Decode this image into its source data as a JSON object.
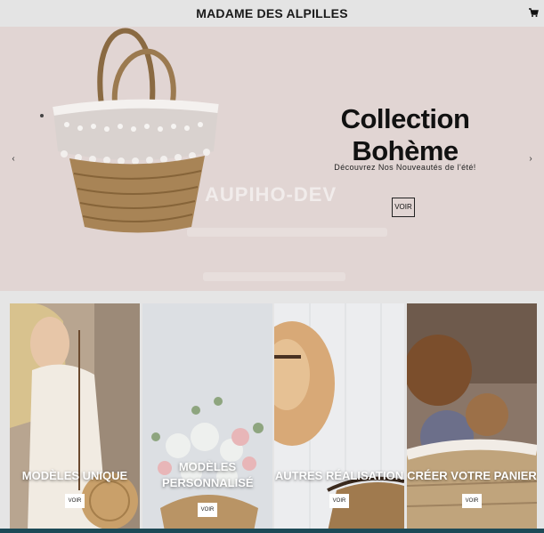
{
  "header": {
    "brand": "MADAME DES ALPILLES",
    "cart_icon": "cart-icon"
  },
  "hero": {
    "title": "Collection Bohème",
    "subtitle": "Découvrez Nos Nouveautés de l'été!",
    "button_label": "VOIR",
    "watermark": "AUPIHO-DEV",
    "prev_icon": "chevron-left-icon",
    "next_icon": "chevron-right-icon"
  },
  "cards": [
    {
      "title": "MODÈLES UNIQUE",
      "button_label": "VOIR"
    },
    {
      "title": "MODÈLES PERSONNALISÉ",
      "button_label": "VOIR"
    },
    {
      "title": "AUTRES RÉALISATION",
      "button_label": "VOIR"
    },
    {
      "title": "CRÉER VOTRE PANIER",
      "button_label": "VOIR"
    }
  ],
  "colors": {
    "hero_bg": "#e1d5d3",
    "header_bg": "#e4e4e4",
    "frame": "#1d4a57"
  }
}
